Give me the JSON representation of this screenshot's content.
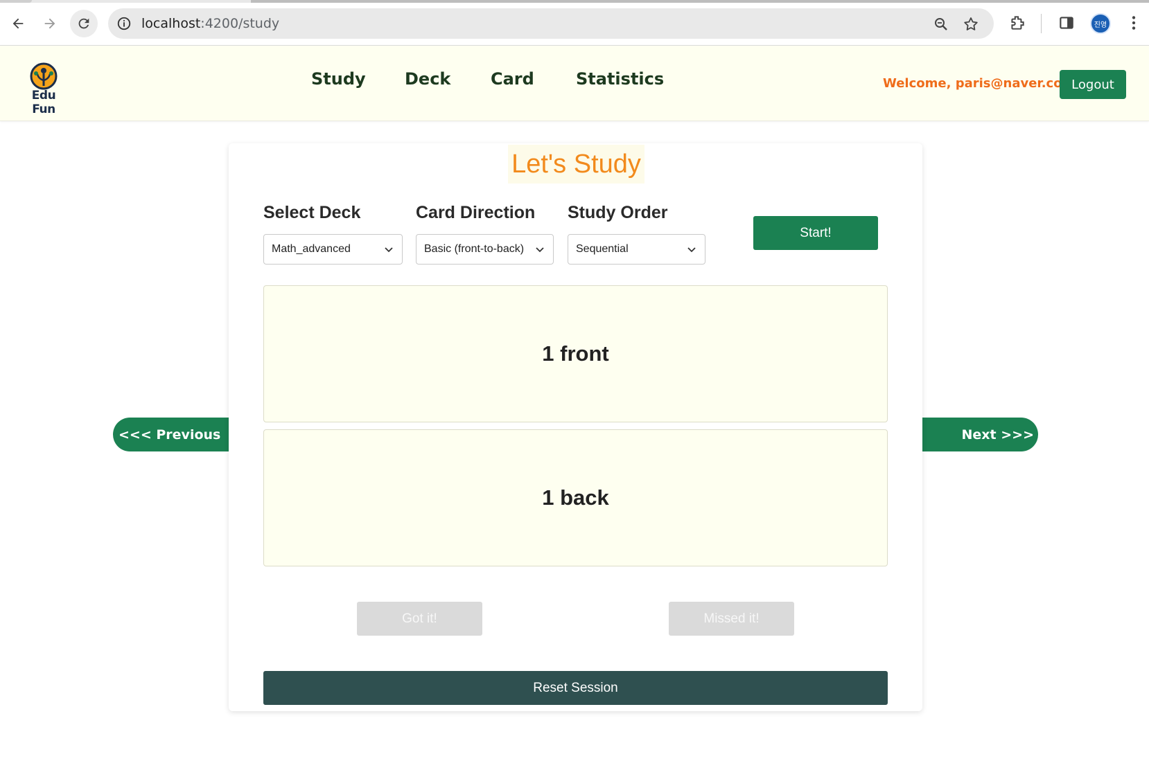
{
  "browser": {
    "url_host": "localhost",
    "url_path": ":4200/study",
    "profile_initials": "진영"
  },
  "header": {
    "logo_text": "Edu Fun",
    "nav": [
      "Study",
      "Deck",
      "Card",
      "Statistics"
    ],
    "welcome_label": "Welcome,",
    "welcome_email": "paris@naver.com!",
    "logout_label": "Logout"
  },
  "study": {
    "title": "Let's Study",
    "select_deck_label": "Select Deck",
    "select_deck_value": "Math_advanced",
    "card_direction_label": "Card Direction",
    "card_direction_value": "Basic (front-to-back)",
    "study_order_label": "Study Order",
    "study_order_value": "Sequential",
    "start_label": "Start!",
    "card_front": "1 front",
    "card_back": "1 back",
    "got_it_label": "Got it!",
    "missed_it_label": "Missed it!",
    "reset_label": "Reset Session",
    "previous_label": "<<< Previous",
    "next_label": "Next >>>"
  },
  "colors": {
    "brand_green": "#1b8152",
    "accent_orange": "#f28a1c",
    "header_bg": "#fefff0",
    "reset_bg": "#2f5050"
  }
}
